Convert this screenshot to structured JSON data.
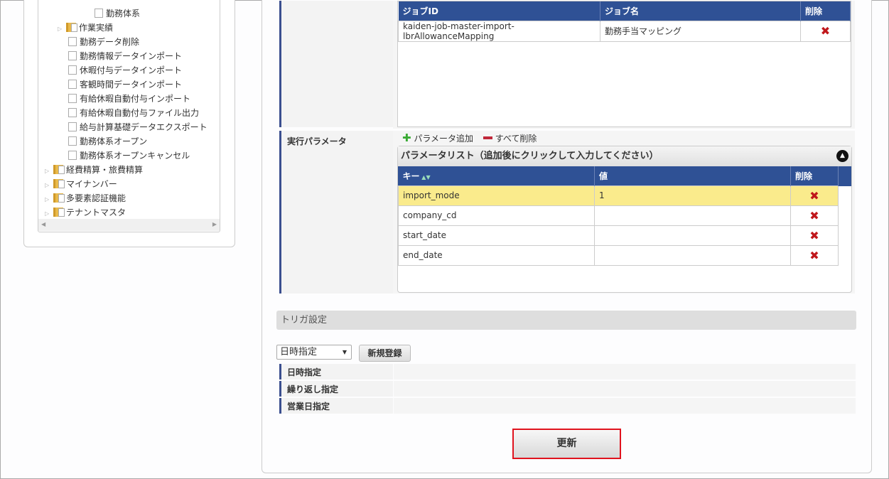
{
  "tree": {
    "items": [
      {
        "label": "勤務体系",
        "type": "doc",
        "level": 3
      },
      {
        "label": "作業実績",
        "type": "folder",
        "level": 1
      },
      {
        "label": "勤務データ削除",
        "type": "doc",
        "level": 2
      },
      {
        "label": "勤務情報データインポート",
        "type": "doc",
        "level": 2
      },
      {
        "label": "休暇付与データインポート",
        "type": "doc",
        "level": 2
      },
      {
        "label": "客観時間データインポート",
        "type": "doc",
        "level": 2
      },
      {
        "label": "有給休暇自動付与インポート",
        "type": "doc",
        "level": 2
      },
      {
        "label": "有給休暇自動付与ファイル出力",
        "type": "doc",
        "level": 2
      },
      {
        "label": "給与計算基礎データエクスポート",
        "type": "doc",
        "level": 2
      },
      {
        "label": "勤務体系オープン",
        "type": "doc",
        "level": 2
      },
      {
        "label": "勤務体系オープンキャンセル",
        "type": "doc",
        "level": 2
      },
      {
        "label": "経費精算・旅費精算",
        "type": "folder",
        "level": 0
      },
      {
        "label": "マイナンバー",
        "type": "folder",
        "level": 0
      },
      {
        "label": "多要素認証機能",
        "type": "folder",
        "level": 0
      },
      {
        "label": "テナントマスタ",
        "type": "folder",
        "level": 0
      }
    ]
  },
  "jobs": {
    "headers": [
      "ジョブID",
      "ジョブ名",
      "削除"
    ],
    "rows": [
      {
        "id": "kaiden-job-master-import-lbrAllowanceMapping",
        "name": "勤務手当マッピング"
      }
    ]
  },
  "params": {
    "label": "実行パラメータ",
    "add_label": "パラメータ追加",
    "delete_all_label": "すべて削除",
    "list_title": "パラメータリスト（追加後にクリックして入力してください）",
    "headers": [
      "キー",
      "値",
      "削除"
    ],
    "rows": [
      {
        "key": "import_mode",
        "value": "1"
      },
      {
        "key": "company_cd",
        "value": ""
      },
      {
        "key": "start_date",
        "value": ""
      },
      {
        "key": "end_date",
        "value": ""
      }
    ]
  },
  "trigger": {
    "title": "トリガ設定",
    "select_value": "日時指定",
    "new_button": "新規登録",
    "rows": [
      "日時指定",
      "繰り返し指定",
      "営業日指定"
    ]
  },
  "update_button": "更新"
}
